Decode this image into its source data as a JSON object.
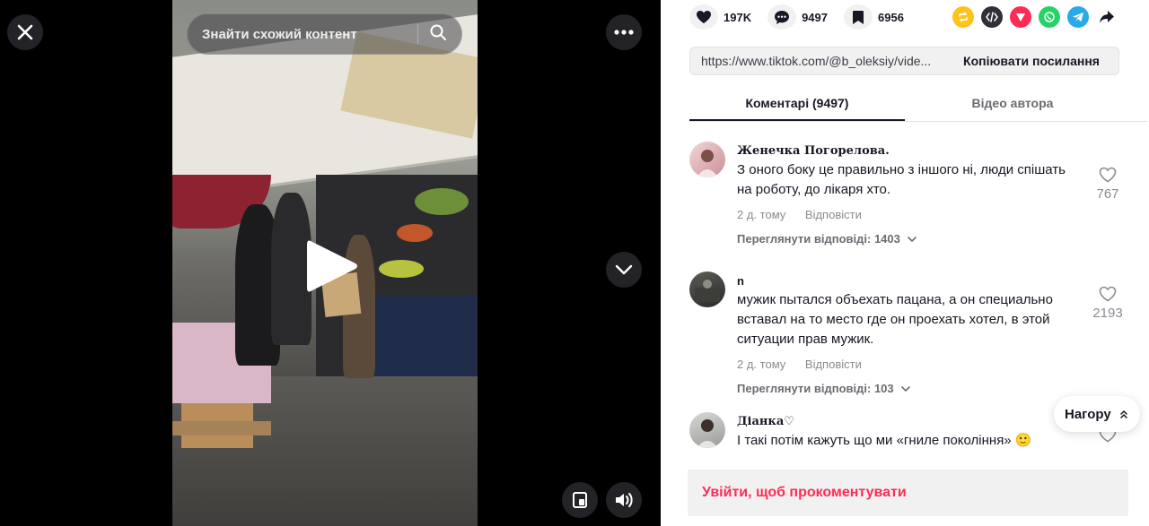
{
  "player": {
    "search_placeholder": "Знайти схожий контент"
  },
  "stats": {
    "likes": "197K",
    "comments": "9497",
    "saves": "6956"
  },
  "share_icons": [
    "repost-icon",
    "embed-icon",
    "send-icon",
    "whatsapp-icon",
    "telegram-icon",
    "share-arrow-icon"
  ],
  "link": {
    "url": "https://www.tiktok.com/@b_oleksiy/vide...",
    "copy_label": "Копіювати посилання"
  },
  "tabs": {
    "comments": "Коментарі (9497)",
    "author_videos": "Відео автора"
  },
  "comments": [
    {
      "author": "Женечка Погорелова.",
      "text": "З оного боку це правильно з іншого ні, люди спішать на роботу, до лікаря хто.",
      "time": "2 д. тому",
      "reply": "Відповісти",
      "replies": "Переглянути відповіді: 1403",
      "likes": "767"
    },
    {
      "author": "n",
      "text": "мужик пытался объехать пацана, а он специально вставал на то место где он проехать хотел, в этой ситуации прав мужик.",
      "time": "2 д. тому",
      "reply": "Відповісти",
      "replies": "Переглянути відповіді: 103",
      "likes": "2193"
    },
    {
      "author": "Діанка♡",
      "text": "І такі потім кажуть що ми «гниле покоління» 🙂",
      "likes": ""
    }
  ],
  "scroll_top_label": "Нагору",
  "login_prompt": "Увійти, щоб прокоментувати",
  "colors": {
    "accent": "#fe2c55",
    "text": "#161823",
    "muted": "#8a8b91"
  }
}
